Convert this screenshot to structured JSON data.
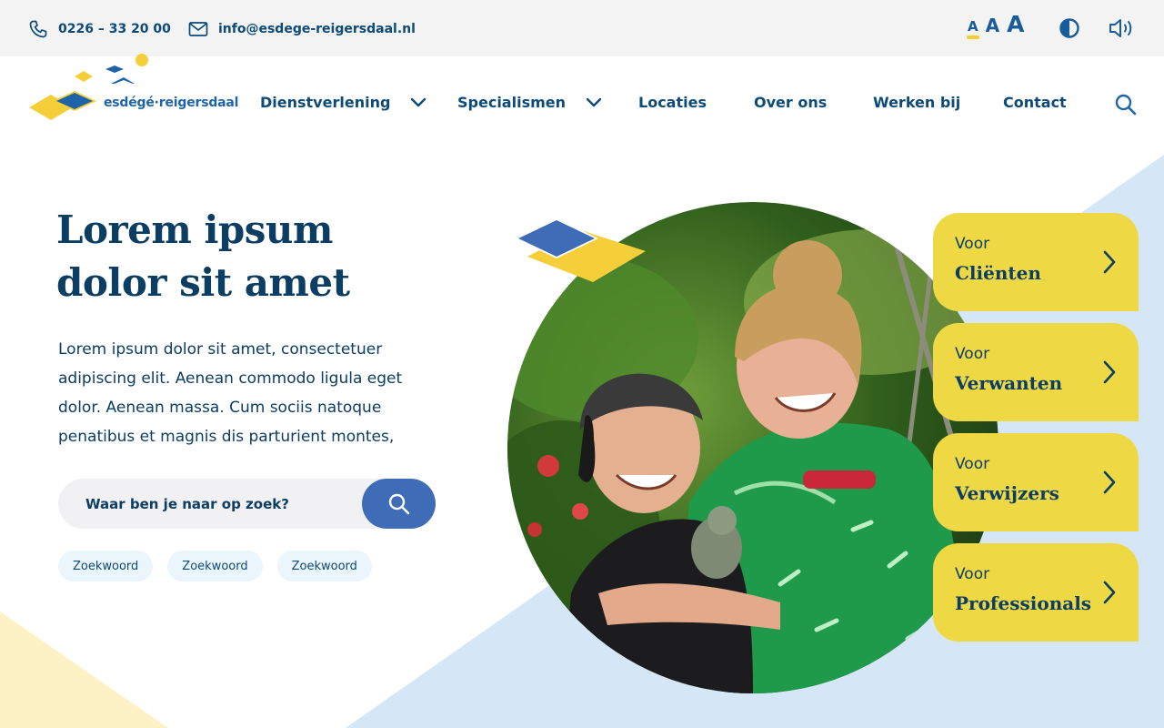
{
  "topbar": {
    "phone": "0226 – 33 20 00",
    "email": "info@esdege-reigersdaal.nl",
    "font_sizes": [
      "A",
      "A",
      "A"
    ],
    "icons": [
      "phone-icon",
      "mail-icon",
      "contrast-icon",
      "speaker-icon"
    ]
  },
  "logo": {
    "text": "esdégé·reigersdaal"
  },
  "nav": {
    "items": [
      {
        "label": "Dienstverlening",
        "dropdown": true
      },
      {
        "label": "Specialismen",
        "dropdown": true
      },
      {
        "label": "Locaties"
      },
      {
        "label": "Over ons"
      },
      {
        "label": "Werken bij"
      },
      {
        "label": "Contact"
      }
    ],
    "search_icon": "search-icon"
  },
  "hero": {
    "title_line1": "Lorem ipsum",
    "title_line2": "dolor sit amet",
    "body": "Lorem ipsum dolor sit amet, consectetuer adipiscing elit. Aenean commodo ligula eget dolor. Aenean massa. Cum sociis natoque penatibus et magnis dis parturient montes,",
    "search": {
      "placeholder": "Waar ben je naar op zoek?"
    },
    "chips": [
      "Zoekwoord",
      "Zoekwoord",
      "Zoekwoord"
    ]
  },
  "cards": [
    {
      "pre": "Voor",
      "label": "Cliënten"
    },
    {
      "pre": "Voor",
      "label": "Verwanten"
    },
    {
      "pre": "Voor",
      "label": "Verwijzers"
    },
    {
      "pre": "Voor",
      "label": "Professionals"
    }
  ],
  "colors": {
    "navy": "#0c3d63",
    "link_blue": "#0c4a79",
    "accent_blue": "#3f6cb6",
    "yellow": "#eed944",
    "light_blue_bg": "#d5e7f7",
    "light_yellow_bg": "#fdf1c6"
  }
}
